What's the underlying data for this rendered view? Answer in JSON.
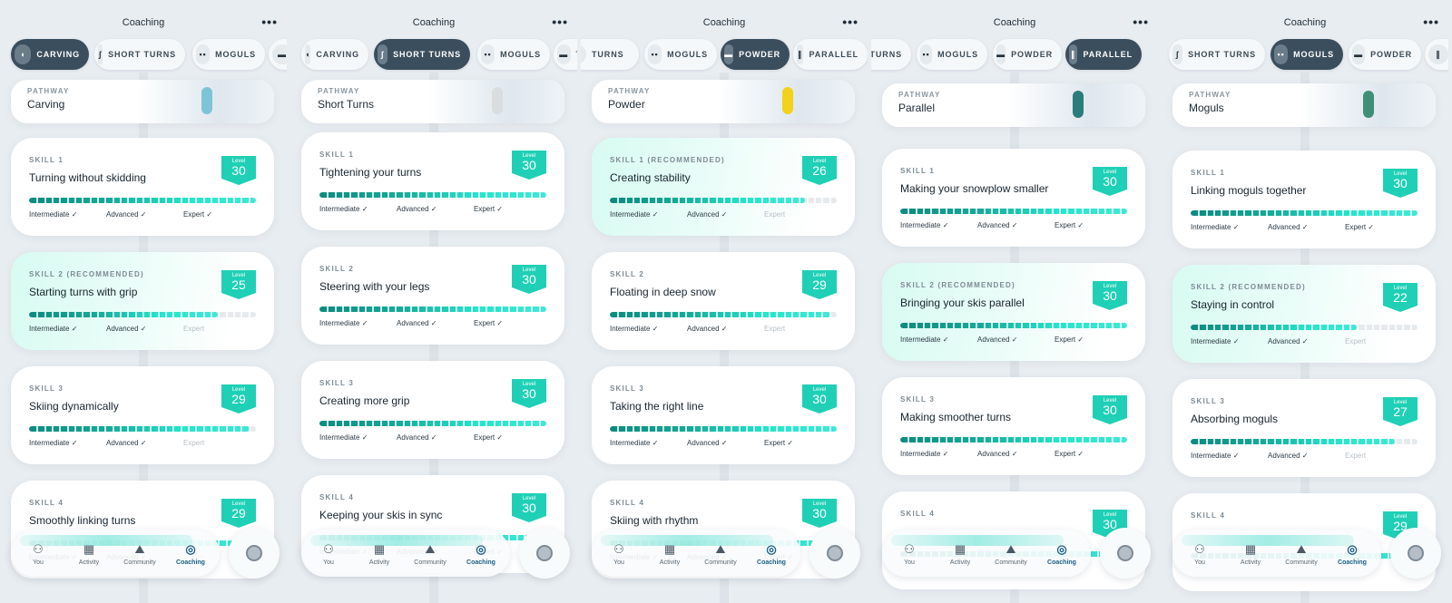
{
  "colors": {
    "accent": "#1fd0b6",
    "active_tab": "#3b4e5d",
    "nav_active": "#1a5f86"
  },
  "screens": [
    {
      "header": {
        "title": "Coaching",
        "more_icon": "more-dots-icon"
      },
      "tabs": [
        {
          "label": "CARVING",
          "icon": "carving-icon",
          "active": true
        },
        {
          "label": "SHORT TURNS",
          "icon": "short-turns-icon",
          "active": false
        },
        {
          "label": "MOGULS",
          "icon": "moguls-icon",
          "active": false
        },
        {
          "label": "",
          "icon": "powder-icon",
          "active": false
        }
      ],
      "pathway": {
        "label": "PATHWAY",
        "name": "Carving"
      },
      "skills": [
        {
          "label": "SKILL 1",
          "name": "Turning without skidding",
          "level_label": "Level",
          "level": "30",
          "progress": 1.0,
          "recommended": false,
          "tiers": [
            {
              "text": "Intermediate ✓",
              "done": true
            },
            {
              "text": "Advanced ✓",
              "done": true
            },
            {
              "text": "Expert ✓",
              "done": true
            }
          ]
        },
        {
          "label": "SKILL 2 (RECOMMENDED)",
          "name": "Starting turns with grip",
          "level_label": "Level",
          "level": "25",
          "progress": 0.83,
          "recommended": true,
          "tiers": [
            {
              "text": "Intermediate ✓",
              "done": true
            },
            {
              "text": "Advanced ✓",
              "done": true
            },
            {
              "text": "Expert",
              "done": false
            }
          ]
        },
        {
          "label": "SKILL 3",
          "name": "Skiing dynamically",
          "level_label": "Level",
          "level": "29",
          "progress": 0.97,
          "recommended": false,
          "tiers": [
            {
              "text": "Intermediate ✓",
              "done": true
            },
            {
              "text": "Advanced ✓",
              "done": true
            },
            {
              "text": "Expert",
              "done": false
            }
          ]
        },
        {
          "label": "SKILL 4",
          "name": "Smoothly linking turns",
          "level_label": "Level",
          "level": "29",
          "progress": 0.97,
          "recommended": false,
          "tiers": [
            {
              "text": "Intermediate ✓",
              "done": true
            },
            {
              "text": "Advanced ✓",
              "done": true
            },
            {
              "text": "Expert",
              "done": false
            }
          ]
        }
      ]
    },
    {
      "header": {
        "title": "Coaching",
        "more_icon": "more-dots-icon"
      },
      "tabs": [
        {
          "label": "CARVING",
          "icon": "carving-icon",
          "active": false
        },
        {
          "label": "SHORT TURNS",
          "icon": "short-turns-icon",
          "active": true
        },
        {
          "label": "MOGULS",
          "icon": "moguls-icon",
          "active": false
        },
        {
          "label": "TURNS",
          "icon": "powder-icon",
          "active": false
        }
      ],
      "pathway": {
        "label": "PATHWAY",
        "name": "Short Turns"
      },
      "skills": [
        {
          "label": "SKILL 1",
          "name": "Tightening your turns",
          "level_label": "Level",
          "level": "30",
          "progress": 1.0,
          "recommended": false,
          "tiers": [
            {
              "text": "Intermediate ✓",
              "done": true
            },
            {
              "text": "Advanced ✓",
              "done": true
            },
            {
              "text": "Expert ✓",
              "done": true
            }
          ]
        },
        {
          "label": "SKILL 2",
          "name": "Steering with your legs",
          "level_label": "Level",
          "level": "30",
          "progress": 1.0,
          "recommended": false,
          "tiers": [
            {
              "text": "Intermediate ✓",
              "done": true
            },
            {
              "text": "Advanced ✓",
              "done": true
            },
            {
              "text": "Expert ✓",
              "done": true
            }
          ]
        },
        {
          "label": "SKILL 3",
          "name": "Creating more grip",
          "level_label": "Level",
          "level": "30",
          "progress": 1.0,
          "recommended": false,
          "tiers": [
            {
              "text": "Intermediate ✓",
              "done": true
            },
            {
              "text": "Advanced ✓",
              "done": true
            },
            {
              "text": "Expert ✓",
              "done": true
            }
          ]
        },
        {
          "label": "SKILL 4",
          "name": "Keeping your skis in sync",
          "level_label": "Level",
          "level": "30",
          "progress": 1.0,
          "recommended": false,
          "tiers": [
            {
              "text": "Intermediate ✓",
              "done": true
            },
            {
              "text": "Advanced ✓",
              "done": true
            },
            {
              "text": "Expert ✓",
              "done": true
            }
          ]
        }
      ]
    },
    {
      "header": {
        "title": "Coaching",
        "more_icon": "more-dots-icon"
      },
      "tabs": [
        {
          "label": "TURNS",
          "icon": "short-turns-icon",
          "active": false
        },
        {
          "label": "MOGULS",
          "icon": "moguls-icon",
          "active": false
        },
        {
          "label": "POWDER",
          "icon": "powder-icon",
          "active": true
        },
        {
          "label": "PARALLEL",
          "icon": "parallel-icon",
          "active": false
        }
      ],
      "pathway": {
        "label": "PATHWAY",
        "name": "Powder"
      },
      "skills": [
        {
          "label": "SKILL 1 (RECOMMENDED)",
          "name": "Creating stability",
          "level_label": "Level",
          "level": "26",
          "progress": 0.86,
          "recommended": true,
          "tiers": [
            {
              "text": "Intermediate ✓",
              "done": true
            },
            {
              "text": "Advanced ✓",
              "done": true
            },
            {
              "text": "Expert",
              "done": false
            }
          ]
        },
        {
          "label": "SKILL 2",
          "name": "Floating in deep snow",
          "level_label": "Level",
          "level": "29",
          "progress": 0.97,
          "recommended": false,
          "tiers": [
            {
              "text": "Intermediate ✓",
              "done": true
            },
            {
              "text": "Advanced ✓",
              "done": true
            },
            {
              "text": "Expert",
              "done": false
            }
          ]
        },
        {
          "label": "SKILL 3",
          "name": "Taking the right line",
          "level_label": "Level",
          "level": "30",
          "progress": 1.0,
          "recommended": false,
          "tiers": [
            {
              "text": "Intermediate ✓",
              "done": true
            },
            {
              "text": "Advanced ✓",
              "done": true
            },
            {
              "text": "Expert ✓",
              "done": true
            }
          ]
        },
        {
          "label": "SKILL 4",
          "name": "Skiing with rhythm",
          "level_label": "Level",
          "level": "30",
          "progress": 1.0,
          "recommended": false,
          "tiers": [
            {
              "text": "Intermediate ✓",
              "done": true
            },
            {
              "text": "Advanced ✓",
              "done": true
            },
            {
              "text": "Expert ✓",
              "done": true
            }
          ]
        }
      ]
    },
    {
      "header": {
        "title": "Coaching",
        "more_icon": "more-dots-icon"
      },
      "tabs": [
        {
          "label": "TURNS",
          "icon": "short-turns-icon",
          "active": false
        },
        {
          "label": "MOGULS",
          "icon": "moguls-icon",
          "active": false
        },
        {
          "label": "POWDER",
          "icon": "powder-icon",
          "active": false
        },
        {
          "label": "PARALLEL",
          "icon": "parallel-icon",
          "active": true
        }
      ],
      "pathway": {
        "label": "PATHWAY",
        "name": "Parallel"
      },
      "skills": [
        {
          "label": "SKILL 1",
          "name": "Making your snowplow smaller",
          "level_label": "Level",
          "level": "30",
          "progress": 1.0,
          "recommended": false,
          "tiers": [
            {
              "text": "Intermediate ✓",
              "done": true
            },
            {
              "text": "Advanced ✓",
              "done": true
            },
            {
              "text": "Expert ✓",
              "done": true
            }
          ]
        },
        {
          "label": "SKILL 2 (RECOMMENDED)",
          "name": "Bringing your skis parallel",
          "level_label": "Level",
          "level": "30",
          "progress": 1.0,
          "recommended": true,
          "tiers": [
            {
              "text": "Intermediate ✓",
              "done": true
            },
            {
              "text": "Advanced ✓",
              "done": true
            },
            {
              "text": "Expert ✓",
              "done": true
            }
          ]
        },
        {
          "label": "SKILL 3",
          "name": "Making smoother turns",
          "level_label": "Level",
          "level": "30",
          "progress": 1.0,
          "recommended": false,
          "tiers": [
            {
              "text": "Intermediate ✓",
              "done": true
            },
            {
              "text": "Advanced ✓",
              "done": true
            },
            {
              "text": "Expert ✓",
              "done": true
            }
          ]
        },
        {
          "label": "SKILL 4",
          "name": "",
          "level_label": "Level",
          "level": "30",
          "progress": 1.0,
          "recommended": false,
          "tiers": []
        }
      ]
    },
    {
      "header": {
        "title": "Coaching",
        "more_icon": "more-dots-icon"
      },
      "tabs": [
        {
          "label": "SHORT TURNS",
          "icon": "short-turns-icon",
          "active": false
        },
        {
          "label": "MOGULS",
          "icon": "moguls-icon",
          "active": true
        },
        {
          "label": "POWDER",
          "icon": "powder-icon",
          "active": false
        },
        {
          "label": "",
          "icon": "parallel-icon",
          "active": false
        }
      ],
      "pathway": {
        "label": "PATHWAY",
        "name": "Moguls"
      },
      "skills": [
        {
          "label": "SKILL 1",
          "name": "Linking moguls together",
          "level_label": "Level",
          "level": "30",
          "progress": 1.0,
          "recommended": false,
          "tiers": [
            {
              "text": "Intermediate ✓",
              "done": true
            },
            {
              "text": "Advanced ✓",
              "done": true
            },
            {
              "text": "Expert ✓",
              "done": true
            }
          ]
        },
        {
          "label": "SKILL 2 (RECOMMENDED)",
          "name": "Staying in control",
          "level_label": "Level",
          "level": "22",
          "progress": 0.73,
          "recommended": true,
          "tiers": [
            {
              "text": "Intermediate ✓",
              "done": true
            },
            {
              "text": "Advanced ✓",
              "done": true
            },
            {
              "text": "Expert",
              "done": false
            }
          ]
        },
        {
          "label": "SKILL 3",
          "name": "Absorbing moguls",
          "level_label": "Level",
          "level": "27",
          "progress": 0.9,
          "recommended": false,
          "tiers": [
            {
              "text": "Intermediate ✓",
              "done": true
            },
            {
              "text": "Advanced ✓",
              "done": true
            },
            {
              "text": "Expert",
              "done": false
            }
          ]
        },
        {
          "label": "SKILL 4",
          "name": "",
          "level_label": "Level",
          "level": "29",
          "progress": 0.97,
          "recommended": false,
          "tiers": []
        }
      ]
    }
  ],
  "bottom_nav": [
    {
      "label": "You",
      "icon": "person-icon",
      "active": false
    },
    {
      "label": "Activity",
      "icon": "calendar-icon",
      "active": false
    },
    {
      "label": "Community",
      "icon": "mountains-icon",
      "active": false
    },
    {
      "label": "Coaching",
      "icon": "target-icon",
      "active": true
    }
  ],
  "fab": {
    "icon": "record-icon"
  }
}
